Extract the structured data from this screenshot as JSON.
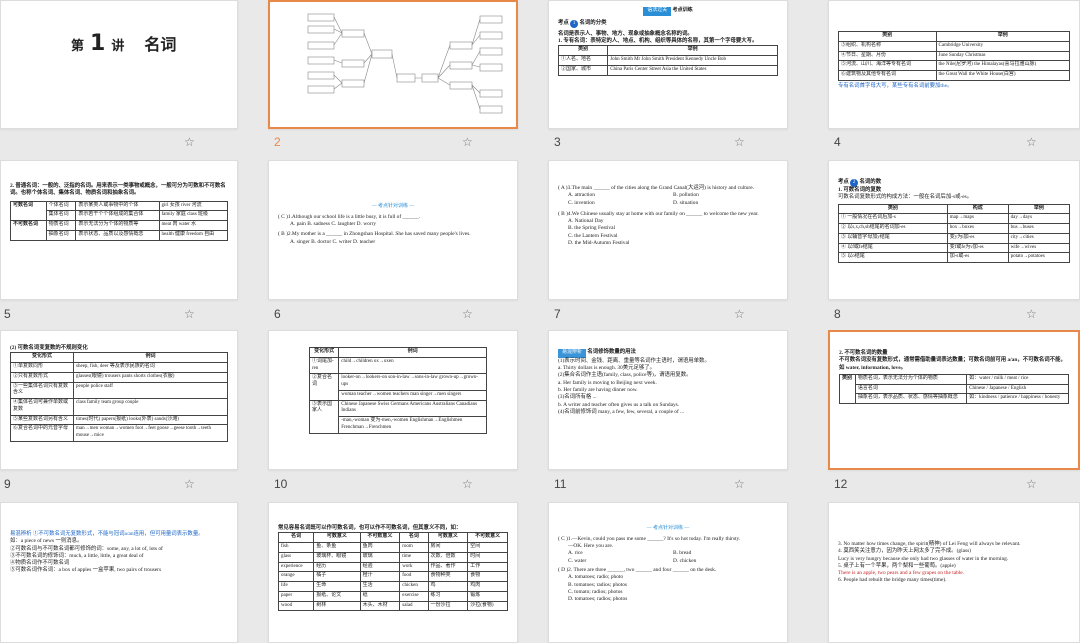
{
  "slides": [
    {
      "num": "",
      "title_pre": "第",
      "title_num": "1",
      "title_post": "讲",
      "title_name": "名词"
    },
    {
      "num": "2"
    },
    {
      "num": "3",
      "banner": "语法过关",
      "banner2": "考点训练",
      "point": "考点",
      "point_title": "名词的分类",
      "line1": "名词是表示人、事物、地方、现象或抽象概念名称的词。",
      "line2": "1. 专有名词：表特定的人、地点、机构、组织等具体的名称，其第一个字母要大写。",
      "rows": [
        [
          "类别",
          "举例"
        ],
        [
          "①人名、地名",
          "John Smith    Mr John Smith    President Kennedy    Uncle Bob"
        ],
        [
          "②国家、城市",
          "China    Paris    Center Street    Asia    the United States"
        ]
      ]
    },
    {
      "num": "4",
      "rows": [
        [
          "类别",
          "举例"
        ],
        [
          "③组织、机构名称",
          "Cambridge University"
        ],
        [
          "④节日、星期、月份",
          "June    Sunday    Christmas"
        ],
        [
          "⑤河流、山川、海洋等专有名词",
          "the Nile(尼罗河)    the Himalayas(喜马拉雅山脉)"
        ],
        [
          "⑥建筑物及其他专有名词",
          "the Great Wall    the White House(白宫)"
        ]
      ],
      "note": "专有名词首字母大写，某些专有名词前要加the。"
    },
    {
      "num": "5",
      "intro": "2. 普通名词：一般的、泛指的名词。用来表示一类事物或概念，一般可分为可数和不可数名词。也称个体名词、集体名词、物质名词和抽象名词。",
      "rows": [
        [
          "可数名词",
          "个体名词",
          "表示某类人或事物中的个体",
          "girl 女孩 river 河流"
        ],
        [
          "",
          "集体名词",
          "表示若干个个体组成的集合体",
          "family 家庭 class 班级"
        ],
        [
          "不可数名词",
          "物质名词",
          "表示无法分为个体的物质等",
          "meat 肉 water 水"
        ],
        [
          "",
          "抽象名词",
          "表示状态、品质以及感情概念",
          "health 健康 freedom 自由"
        ]
      ]
    },
    {
      "num": "6",
      "divider": "— 考点针对训练 —",
      "q1": "( C )1.Although our school life is a little busy, it is full of ______.",
      "q1o": "A. pain    B. sadness    C. laughter    D. worry",
      "q2": "( B )2.My mother is a ______ in Zhongshan Hospital. She has saved many people's lives.",
      "q2o": "A. singer    B. doctor    C. writer    D. teacher"
    },
    {
      "num": "7",
      "q3": "( A )3.The main ______ of the cities along the Grand Canal(大运河) is history and culture.",
      "q3o": [
        "A. attraction",
        "B. pollution",
        "C. invention",
        "D. situation"
      ],
      "q4": "( B )4.We Chinese usually stay at home with our family on ______ to welcome the new year.",
      "q4o": [
        "A. National Day",
        "B. the Spring Festival",
        "C. the Lantern Festival",
        "D. the Mid-Autumn Festival"
      ]
    },
    {
      "num": "8",
      "point": "考点",
      "point_title": "名词的数",
      "h": "1. 可数名词的复数",
      "body": "可数名词复数形式的构成方法：一般在名词后加-s或-es。",
      "rows": [
        [
          "类别",
          "构成",
          "举例"
        ],
        [
          "① 一般情况在名词后加-s",
          "map→maps",
          "day→days"
        ],
        [
          "② 以s,x,ch,sh结尾的名词加-es",
          "box→boxes",
          "bus→buses"
        ],
        [
          "③ 以辅音字母加y结尾",
          "变y为i加-es",
          "city→cities"
        ],
        [
          "④ 以f或fe结尾",
          "变f或fe为v加-es",
          "wife→wives"
        ],
        [
          "⑤ 以o结尾",
          "加-s或-es",
          "potato→potatoes"
        ]
      ]
    },
    {
      "num": "9",
      "h": "(2) 可数名词变复数的不规则变化",
      "rows": [
        [
          "变化形式",
          "例词"
        ],
        [
          "①单复数同形",
          "sheep, fish, deer 等及表示民族的名词"
        ],
        [
          "②只有复数形式",
          "glasses(眼镜) trousers pants shorts clothes(衣服)"
        ],
        [
          "③一些集体名词只有复数含义",
          "people police staff"
        ],
        [
          "④集体名词可兼作单数或复数",
          "class family team group couple"
        ],
        [
          "⑤某些复数名词另有含义",
          "times(时代) papers(报纸) looks(外表) sands(沙滩)"
        ],
        [
          "⑥复合名词中的元音字母",
          "man→men woman→women foot→feet goose→geese tooth→teeth mouse→mice"
        ]
      ]
    },
    {
      "num": "10",
      "rows": [
        [
          "变化形式",
          "例词"
        ],
        [
          "①词尾加-ren",
          "child→children  ox→oxen"
        ],
        [
          "②复合名词",
          "looker-on→lookers-on  son-in-law→sons-in-law  grown-up→grown-ups"
        ],
        [
          "",
          "woman teacher→women teachers  man singer→men singers"
        ],
        [
          "③表示国家人",
          "Chinese  Japanese  Swiss  Germans  Americans  Australians  Canadians  Indians"
        ],
        [
          "",
          "-man,-woman 变为-men,-women  Englishman→Englishmen  Frenchman→Frenchmen"
        ]
      ]
    },
    {
      "num": "11",
      "box": "易混辨析",
      "h": "名词修饰数量的用法",
      "lines": [
        "(1)表示时间、金钱、距离、重量等名词作主语时，谓语用单数。",
        "a. Thirty dollars is enough. 30美元足够了。",
        "(2)集合名词作主语(family, class, police等)，谓语用复数。",
        "a. Her family is moving to Beijing next week.",
        "b. Her family are having dinner now.",
        "(3)名词所有格 ...",
        "b. A writer and teacher often gives us a talk on Sundays.",
        "(4)名词前修饰词 many, a few, few, several, a couple of ..."
      ]
    },
    {
      "num": "12",
      "h": "2. 不可数名词的数量",
      "body": "不可数名词没有复数形式，通常需借助量词表达数量；可数名词前可用 a/an，不可数名词不能，如 water, information, love。",
      "rows": [
        [
          "类别",
          "物质名词，表示无法分为个体的物质",
          "如：water / milk / meat / rice"
        ],
        [
          "",
          "语言名词",
          "Chinese / Japanese / English"
        ],
        [
          "",
          "抽象名词，表示品质、状态、感情等抽象概念",
          "如：kindness / patience / happiness / honesty"
        ]
      ]
    },
    {
      "num": "",
      "lines": [
        "易混辨析 ①不可数名词无复数形式，不能与冠词a/an连用，但可用量词表示数量。",
        "如：a piece of news 一则消息。",
        "②可数名词与不可数名词都可修饰的词：some, any, a lot of, lots of",
        "③不可数名词的修饰词：much, a little, little, a great deal of",
        "④物质名词作不可数名词",
        "⑤可数名词作名词：a box of apples 一盒苹果, two pairs of trousers"
      ]
    },
    {
      "num": "",
      "cap": "常见容易名词既可以作可数名词，也可以作不可数名词，但其意义不同，如：",
      "rows": [
        [
          "名词",
          "可数意义",
          "不可数意义",
          "名词",
          "可数意义",
          "不可数意义"
        ],
        [
          "fish",
          "鱼、条鱼",
          "鱼肉",
          "room",
          "房间",
          "空间"
        ],
        [
          "glass",
          "玻璃杯、眼镜",
          "玻璃",
          "time",
          "次数、倍数",
          "时间"
        ],
        [
          "experience",
          "经历",
          "经验",
          "work",
          "作品、著作",
          "工作"
        ],
        [
          "orange",
          "橘子",
          "橙汁",
          "food",
          "食物种类",
          "食物"
        ],
        [
          "life",
          "生命",
          "生活",
          "chicken",
          "鸡",
          "鸡肉"
        ],
        [
          "paper",
          "报纸、论文",
          "纸",
          "exercise",
          "练习",
          "锻炼"
        ],
        [
          "wood",
          "树林",
          "木头、木材",
          "salad",
          "一份沙拉",
          "沙拉(食物)"
        ]
      ]
    },
    {
      "num": "",
      "divider": "— 考点针对训练 —",
      "q1": "( C )1.—Kevin, could you pass me some ______?  It's so hot today. I'm really thirsty.",
      "q1b": "—OK. Here you are.",
      "q1o": [
        "A. rice",
        "B. bread",
        "C. water",
        "D. chicken"
      ],
      "q2": "( D )2. There are three ______, two ______ and four ______ on the desk.",
      "q2o": [
        "A. tomatoes; radio; photo",
        "B. tomatoes; radios; photos",
        "C. tomato; radios; photos",
        "D. tomatoes; radios; photos"
      ]
    },
    {
      "num": "",
      "lines": [
        "3. No matter how times change, the spirit(精神) of Lei Feng will always be relevant.",
        "4. 莫西笑关注意力，因为昨天上网太多了完不成。(glass)",
        "Lucy is very hungry because she only had two glasses of water in the morning.",
        "5. 桌子上有一个苹果，两个梨和一些葡萄。(apple)",
        "There is an apple, two pears and a few grapes on the table.",
        "6. People had rebuilt the bridge many times(time)."
      ]
    }
  ],
  "star_icon": "☆",
  "colors": {
    "accent": "#e8894a",
    "blue": "#1e66c6",
    "red": "#c62828"
  }
}
